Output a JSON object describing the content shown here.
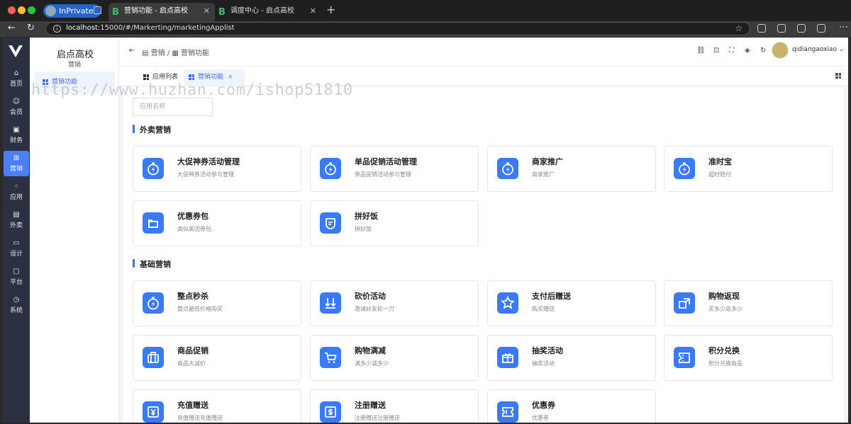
{
  "browser": {
    "profile_label": "InPrivate",
    "tabs": [
      {
        "title": "营销功能 - 启点高校",
        "icon": "B"
      },
      {
        "title": "调度中心 - 启点高校",
        "icon": "B"
      }
    ],
    "url_host": "localhost",
    "url_path": ":15000/#/Markerting/marketingApplist"
  },
  "nav": {
    "items": [
      {
        "label": "首页",
        "icon": "home-icon",
        "glyph": "⌂"
      },
      {
        "label": "会员",
        "icon": "member-icon",
        "glyph": "☺"
      },
      {
        "label": "财务",
        "icon": "finance-icon",
        "glyph": "▣"
      },
      {
        "label": "营销",
        "icon": "marketing-icon",
        "glyph": "⊞"
      },
      {
        "label": "应用",
        "icon": "apps-icon",
        "glyph": "⁘"
      },
      {
        "label": "外卖",
        "icon": "takeout-icon",
        "glyph": "▤"
      },
      {
        "label": "设计",
        "icon": "design-icon",
        "glyph": "▭"
      },
      {
        "label": "平台",
        "icon": "platform-icon",
        "glyph": "▢"
      },
      {
        "label": "系统",
        "icon": "system-icon",
        "glyph": "◷"
      }
    ],
    "active_index": 3
  },
  "submenu": {
    "title": "启点高校",
    "group": "营销",
    "item": "营销功能"
  },
  "topbar": {
    "breadcrumb": [
      "营销",
      "营销功能"
    ],
    "user_name": "qidiangaoxiao",
    "icons": [
      "link-icon",
      "lock-icon",
      "fullscreen-icon",
      "theme-icon",
      "refresh-icon"
    ]
  },
  "page_tabs": {
    "list": "应用列表",
    "marketing": "营销功能",
    "close": "×"
  },
  "search": {
    "placeholder": "应用名称"
  },
  "sections": [
    {
      "title": "外卖营销",
      "cards": [
        {
          "title": "大促神券活动管理",
          "desc": "大促神券活动参与管理",
          "icon": "stopwatch-icon"
        },
        {
          "title": "单品促销活动管理",
          "desc": "单品促销活动参与管理",
          "icon": "stopwatch-icon"
        },
        {
          "title": "商家推广",
          "desc": "商家推广",
          "icon": "stopwatch-icon"
        },
        {
          "title": "准时宝",
          "desc": "超时赔付",
          "icon": "stopwatch-icon"
        },
        {
          "title": "优惠券包",
          "desc": "类似美团券包",
          "icon": "folder-icon"
        },
        {
          "title": "拼好饭",
          "desc": "拼好饭",
          "icon": "badge-icon"
        }
      ]
    },
    {
      "title": "基础营销",
      "cards": [
        {
          "title": "整点秒杀",
          "desc": "整点最低价格购买",
          "icon": "stopwatch-icon"
        },
        {
          "title": "砍价活动",
          "desc": "邀请好友砍一刀",
          "icon": "cut-price-icon"
        },
        {
          "title": "支付后赠送",
          "desc": "购买赠送",
          "icon": "star-icon"
        },
        {
          "title": "购物返现",
          "desc": "买多少返多少",
          "icon": "return-icon"
        },
        {
          "title": "商品促销",
          "desc": "商品大减价",
          "icon": "bag-icon"
        },
        {
          "title": "购物满减",
          "desc": "满多少减多少",
          "icon": "cart-icon"
        },
        {
          "title": "抽奖活动",
          "desc": "抽奖活动",
          "icon": "gift-icon"
        },
        {
          "title": "积分兑换",
          "desc": "积分兑换商品",
          "icon": "ticket-icon"
        },
        {
          "title": "充值赠送",
          "desc": "充值赠送充值赠送",
          "icon": "yen-icon"
        },
        {
          "title": "注册赠送",
          "desc": "注册赠送注册赠送",
          "icon": "dollar-icon"
        },
        {
          "title": "优惠券",
          "desc": "优惠券",
          "icon": "coupon-icon"
        }
      ]
    }
  ],
  "watermark": "https://www.huzhan.com/ishop51810",
  "colors": {
    "accent": "#3a7af7",
    "sidebar_bg": "#2b3140",
    "active_nav": "#4a7ff5"
  }
}
